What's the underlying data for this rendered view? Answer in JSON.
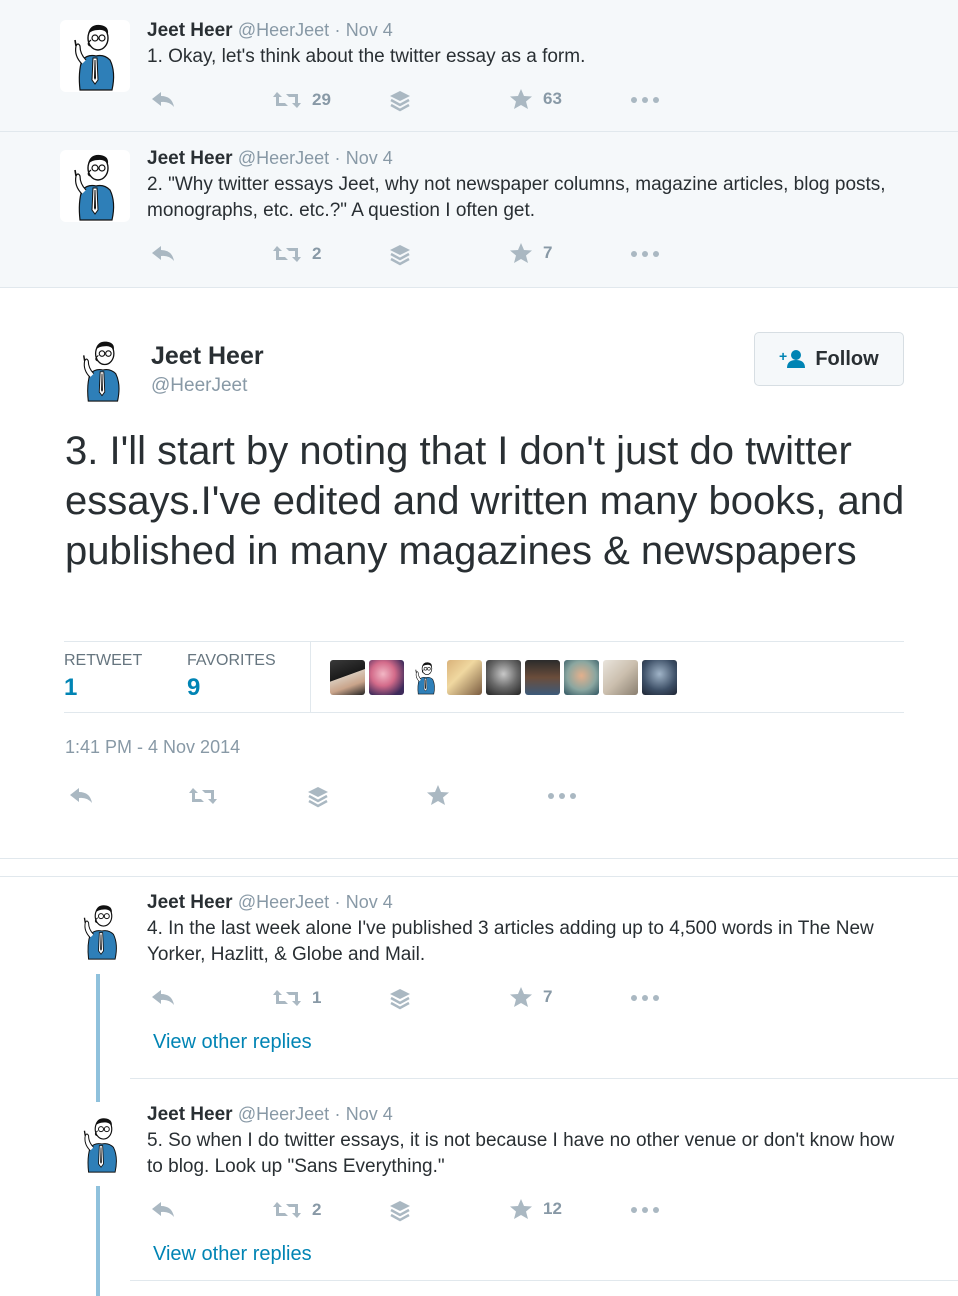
{
  "tweets_above": [
    {
      "name": "Jeet Heer",
      "handle": "@HeerJeet",
      "dot": "·",
      "time": "Nov 4",
      "text": "1. Okay, let's think about the twitter essay as a form.",
      "retweets": "29",
      "favorites": "63"
    },
    {
      "name": "Jeet Heer",
      "handle": "@HeerJeet",
      "dot": "·",
      "time": "Nov 4",
      "text": "2. \"Why twitter essays Jeet, why not newspaper columns, magazine articles, blog posts, monographs, etc. etc.?\" A question I often get.",
      "retweets": "2",
      "favorites": "7"
    }
  ],
  "main_tweet": {
    "name": "Jeet Heer",
    "handle": "@HeerJeet",
    "follow_label": "Follow",
    "text": "3. I'll start by noting that I don't just do twitter essays.I've edited and written many books, and published in many magazines & newspapers",
    "retweet_label": "RETWEET",
    "retweet_count": "1",
    "favorites_label": "FAVORITES",
    "favorites_count": "9",
    "timestamp": "1:41 PM - 4 Nov 2014"
  },
  "replies": [
    {
      "name": "Jeet Heer",
      "handle": "@HeerJeet",
      "dot": "·",
      "time": "Nov 4",
      "text": "4. In the last week alone I've published 3 articles adding up to 4,500 words in The New Yorker, Hazlitt, & Globe and Mail.",
      "retweets": "1",
      "favorites": "7",
      "view_replies": "View other replies"
    },
    {
      "name": "Jeet Heer",
      "handle": "@HeerJeet",
      "dot": "·",
      "time": "Nov 4",
      "text": "5. So when I do twitter essays, it is not because I have no other venue or don't know how to blog. Look up \"Sans Everything.\"",
      "retweets": "2",
      "favorites": "12",
      "view_replies": "View other replies"
    }
  ],
  "colors": {
    "link": "#0084b4",
    "icon_gray": "#aab8c2",
    "thread_line": "#8fc1dc",
    "avatar_blue": "#2e7fb8"
  },
  "icons": [
    "reply-icon",
    "retweet-icon",
    "buffer-icon",
    "favorite-icon",
    "more-icon",
    "follow-person-icon"
  ]
}
